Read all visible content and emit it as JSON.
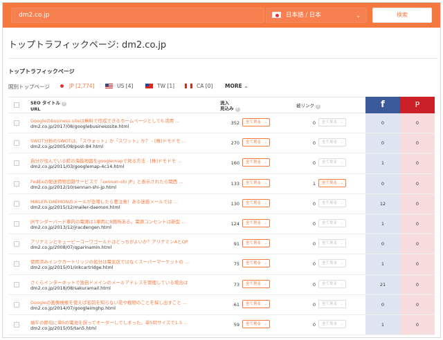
{
  "search": {
    "domain": "dm2.co.jp",
    "language": "日本語 / 日本",
    "button": "検索"
  },
  "page_title": "トップトラフィックページ: dm2.co.jp",
  "section_title": "トップトラフィックページ",
  "countries": {
    "label": "国別トップページ",
    "items": [
      {
        "code": "JP",
        "count": "[2,774]"
      },
      {
        "code": "US",
        "count": "[4]"
      },
      {
        "code": "TW",
        "count": "[1]"
      },
      {
        "code": "CA",
        "count": "[0]"
      }
    ],
    "more": "MORE"
  },
  "table": {
    "headers": {
      "title_line1": "SEO タイトル",
      "title_line2": "URL",
      "traffic_line1": "流入",
      "traffic_line2": "見込み",
      "backlinks": "被リンク",
      "facebook": "f",
      "pinterest": "P"
    },
    "view_all": "全て見る",
    "rows": [
      {
        "title": "Googleのbusiness siteは無料で作成できるホームページとしても活用 ...",
        "url": "dm2.co.jp/2017/08/googlebusinesssite.html",
        "traffic": "352",
        "backlinks": "0",
        "fb": "0",
        "pin": "0"
      },
      {
        "title": "SWOT分析のSWOTは、「スウォット」か「スワット」か？ - [株]ドモドモ ...",
        "url": "dm2.co.jp/2005/08/post-84.html",
        "traffic": "270",
        "backlinks": "0",
        "fb": "0",
        "pin": "0"
      },
      {
        "title": "自分が住んでいる町の海抜地図をgooglemapで見る方法 - [株]ドモドモ ...",
        "url": "dm2.co.jp/2011/03/googlemap-4c14.html",
        "traffic": "160",
        "backlinks": "0",
        "fb": "1",
        "pin": "0"
      },
      {
        "title": "FedExの配送荷物追跡サービスで「sennan-shi JP」と表示されたら関西 ...",
        "url": "dm2.co.jp/2012/10/sennan-shi-jp.html",
        "traffic": "133",
        "backlinks": "1",
        "fb": "0",
        "pin": "0"
      },
      {
        "title": "MAILER-DAEMONのメールが急増したら要注意！ある迷惑メールでは ...",
        "url": "dm2.co.jp/2015/12/mailer-daemon.html",
        "traffic": "130",
        "backlinks": "0",
        "fb": "12",
        "pin": "0"
      },
      {
        "title": "JRサンダーバード車内の電源は1車両に8箇所ある。電源コンセントは新型 ...",
        "url": "dm2.co.jp/2013/12/jracdengen.html",
        "traffic": "124",
        "backlinks": "0",
        "fb": "1",
        "pin": "0"
      },
      {
        "title": "アリナミンとキューピーコーワゴールドはどっちがよいか？アリナミンAとQP ...",
        "url": "dm2.co.jp/2008/07/qparinamin.html",
        "traffic": "91",
        "backlinks": "0",
        "fb": "0",
        "pin": "0"
      },
      {
        "title": "使用済みインクカートリッジの処分は電気店ではなくスーパーマーケットの ...",
        "url": "dm2.co.jp/2015/01/inkcartridge.html",
        "traffic": "75",
        "backlinks": "0",
        "fb": "1",
        "pin": "0"
      },
      {
        "title": "さくらインターネットで独自ドメインのメールアドレスを管理している場合は ...",
        "url": "dm2.co.jp/2018/08/sakuramail.html",
        "traffic": "73",
        "backlinks": "0",
        "fb": "21",
        "pin": "0"
      },
      {
        "title": "Googleの画像検索を使えば名前を知らない花や植物のことを探し出すこと ...",
        "url": "dm2.co.jp/2014/07/googleimghp.html",
        "traffic": "61",
        "backlinks": "0",
        "fb": "0",
        "pin": "0"
      },
      {
        "title": "端午の節句に単5の電池を誤ってオーダーしてしまった。単5同サイズで1.5 ...",
        "url": "dm2.co.jp/2015/05/tan5.html",
        "traffic": "59",
        "backlinks": "0",
        "fb": "1",
        "pin": "0"
      }
    ]
  },
  "colors": {
    "accent": "#f5793f",
    "facebook": "#3b5998",
    "pinterest": "#cb2027"
  }
}
